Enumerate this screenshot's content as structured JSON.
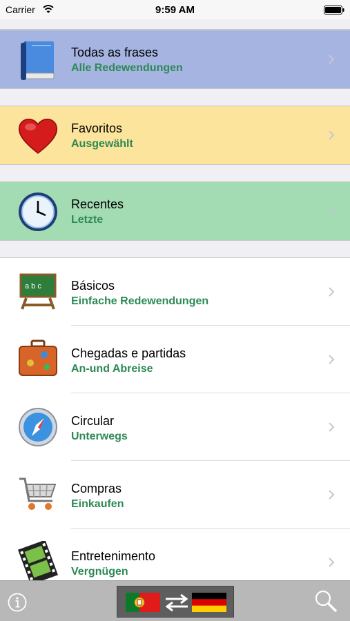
{
  "status_bar": {
    "carrier": "Carrier",
    "time": "9:59 AM"
  },
  "featured": [
    {
      "title": "Todas as frases",
      "subtitle": "Alle Redewendungen",
      "icon": "book-icon"
    },
    {
      "title": "Favoritos",
      "subtitle": "Ausgewählt",
      "icon": "heart-icon"
    },
    {
      "title": "Recentes",
      "subtitle": "Letzte",
      "icon": "clock-icon"
    }
  ],
  "categories": [
    {
      "title": "Básicos",
      "subtitle": "Einfache Redewendungen",
      "icon": "chalkboard-icon"
    },
    {
      "title": "Chegadas e partidas",
      "subtitle": "An-und Abreise",
      "icon": "suitcase-icon"
    },
    {
      "title": "Circular",
      "subtitle": "Unterwegs",
      "icon": "compass-icon"
    },
    {
      "title": "Compras",
      "subtitle": "Einkaufen",
      "icon": "shopping-cart-icon"
    },
    {
      "title": "Entretenimento",
      "subtitle": "Vergnügen",
      "icon": "film-strip-icon"
    }
  ],
  "toolbar": {
    "info_icon": "info-icon",
    "language_switch": {
      "from_flag": "portugal-flag-icon",
      "to_flag": "germany-flag-icon",
      "arrows": "swap-arrows-icon"
    },
    "search_icon": "search-icon"
  },
  "colors": {
    "featured_all": "#a6b4e2",
    "featured_favorites": "#fde49c",
    "featured_recent": "#a3dcb2",
    "subtitle_green": "#2c8a55"
  }
}
